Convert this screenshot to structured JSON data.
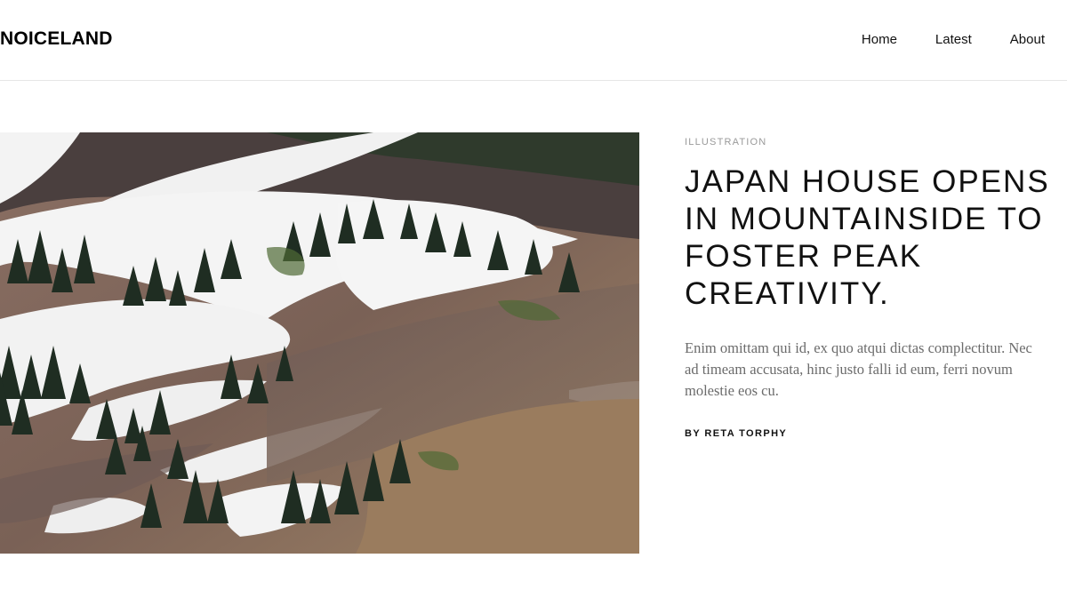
{
  "site": {
    "logo": "NOICELAND",
    "nav": [
      "Home",
      "Latest",
      "About"
    ]
  },
  "post": {
    "category": "Illustration",
    "title": "Japan House Opens in Mountainside to Foster Peak Creativity.",
    "excerpt": "Enim omittam qui id, ex quo atqui dictas complectitur. Nec ad timeam accusata, hinc justo falli id eum, ferri novum molestie eos cu.",
    "byline_prefix": "By",
    "author": "Reta Torphy",
    "image_alt": "Snowy mountain slopes with evergreen trees"
  }
}
